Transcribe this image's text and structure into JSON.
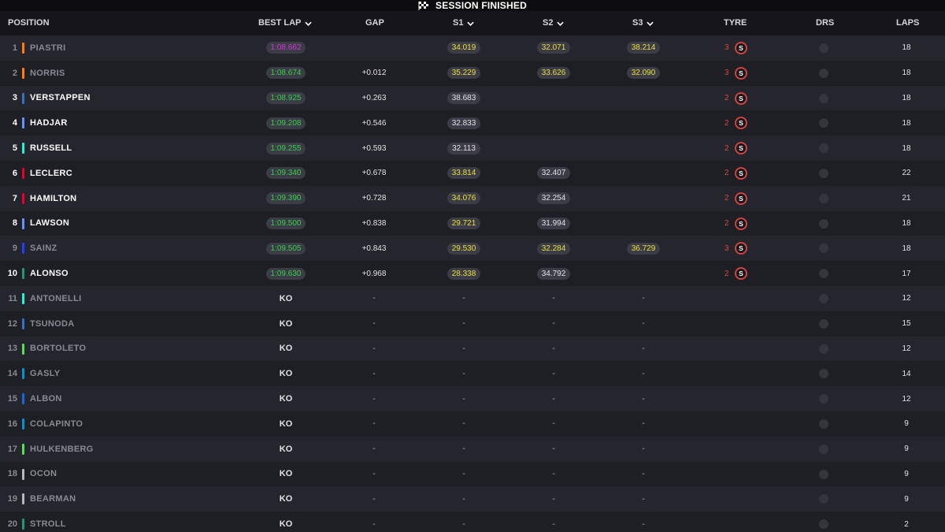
{
  "session": {
    "title": "SESSION FINISHED"
  },
  "columns": {
    "position": "POSITION",
    "best_lap": "BEST LAP",
    "gap": "GAP",
    "s1": "S1",
    "s2": "S2",
    "s3": "S3",
    "tyre": "TYRE",
    "drs": "DRS",
    "laps": "LAPS"
  },
  "colors": {
    "purple": "#d236d8",
    "green": "#34d049",
    "yellow": "#e7e03a",
    "tyre_soft": "#e0463f"
  },
  "tyre_compound": "S",
  "rows": [
    {
      "pos": "1",
      "driver": "PIASTRI",
      "team_color": "#ff8000",
      "dim": true,
      "best_lap": "1:08.662",
      "best_lap_color": "purple",
      "gap": "",
      "s1": "34.019",
      "s1c": "yellow",
      "s2": "32.071",
      "s2c": "yellow",
      "s3": "38.214",
      "s3c": "yellow",
      "tyre_age": "3",
      "tyre": true,
      "laps": "18"
    },
    {
      "pos": "2",
      "driver": "NORRIS",
      "team_color": "#ff8000",
      "dim": true,
      "best_lap": "1:08.674",
      "best_lap_color": "green",
      "gap": "+0.012",
      "s1": "35.229",
      "s1c": "yellow",
      "s2": "33.626",
      "s2c": "yellow",
      "s3": "32.090",
      "s3c": "yellow",
      "tyre_age": "3",
      "tyre": true,
      "laps": "18"
    },
    {
      "pos": "3",
      "driver": "VERSTAPPEN",
      "team_color": "#3671c6",
      "dim": false,
      "best_lap": "1:08.925",
      "best_lap_color": "green",
      "gap": "+0.263",
      "s1": "38.683",
      "s1c": "white",
      "s2": "",
      "s2c": "",
      "s3": "",
      "s3c": "",
      "tyre_age": "2",
      "tyre": true,
      "laps": "18"
    },
    {
      "pos": "4",
      "driver": "HADJAR",
      "team_color": "#6692ff",
      "dim": false,
      "best_lap": "1:09.208",
      "best_lap_color": "green",
      "gap": "+0.546",
      "s1": "32.833",
      "s1c": "white",
      "s2": "",
      "s2c": "",
      "s3": "",
      "s3c": "",
      "tyre_age": "2",
      "tyre": true,
      "laps": "18"
    },
    {
      "pos": "5",
      "driver": "RUSSELL",
      "team_color": "#27f4d2",
      "dim": false,
      "best_lap": "1:09.255",
      "best_lap_color": "green",
      "gap": "+0.593",
      "s1": "32.113",
      "s1c": "white",
      "s2": "",
      "s2c": "",
      "s3": "",
      "s3c": "",
      "tyre_age": "2",
      "tyre": true,
      "laps": "18"
    },
    {
      "pos": "6",
      "driver": "LECLERC",
      "team_color": "#e8002d",
      "dim": false,
      "best_lap": "1:09.340",
      "best_lap_color": "green",
      "gap": "+0.678",
      "s1": "33.814",
      "s1c": "yellow",
      "s2": "32.407",
      "s2c": "white",
      "s3": "",
      "s3c": "",
      "tyre_age": "2",
      "tyre": true,
      "laps": "22"
    },
    {
      "pos": "7",
      "driver": "HAMILTON",
      "team_color": "#e8002d",
      "dim": false,
      "best_lap": "1:09.390",
      "best_lap_color": "green",
      "gap": "+0.728",
      "s1": "34.076",
      "s1c": "yellow",
      "s2": "32.254",
      "s2c": "white",
      "s3": "",
      "s3c": "",
      "tyre_age": "2",
      "tyre": true,
      "laps": "21"
    },
    {
      "pos": "8",
      "driver": "LAWSON",
      "team_color": "#6692ff",
      "dim": false,
      "best_lap": "1:09.500",
      "best_lap_color": "green",
      "gap": "+0.838",
      "s1": "29.721",
      "s1c": "yellow",
      "s2": "31.994",
      "s2c": "white",
      "s3": "",
      "s3c": "",
      "tyre_age": "2",
      "tyre": true,
      "laps": "18"
    },
    {
      "pos": "9",
      "driver": "SAINZ",
      "team_color": "#1e41ff",
      "dim": true,
      "best_lap": "1:09.505",
      "best_lap_color": "green",
      "gap": "+0.843",
      "s1": "29.530",
      "s1c": "yellow",
      "s2": "32.284",
      "s2c": "yellow",
      "s3": "36.729",
      "s3c": "yellow",
      "tyre_age": "3",
      "tyre": true,
      "laps": "18"
    },
    {
      "pos": "10",
      "driver": "ALONSO",
      "team_color": "#229971",
      "dim": false,
      "best_lap": "1:09.630",
      "best_lap_color": "green",
      "gap": "+0.968",
      "s1": "28.338",
      "s1c": "yellow",
      "s2": "34.792",
      "s2c": "white",
      "s3": "",
      "s3c": "",
      "tyre_age": "2",
      "tyre": true,
      "laps": "17"
    },
    {
      "pos": "11",
      "driver": "ANTONELLI",
      "team_color": "#27f4d2",
      "dim": true,
      "best_lap": "KO",
      "best_lap_color": "ko",
      "gap": "-",
      "s1": "-",
      "s1c": "dash",
      "s2": "-",
      "s2c": "dash",
      "s3": "-",
      "s3c": "dash",
      "tyre_age": "",
      "tyre": false,
      "laps": "12"
    },
    {
      "pos": "12",
      "driver": "TSUNODA",
      "team_color": "#3671c6",
      "dim": true,
      "best_lap": "KO",
      "best_lap_color": "ko",
      "gap": "-",
      "s1": "-",
      "s1c": "dash",
      "s2": "-",
      "s2c": "dash",
      "s3": "-",
      "s3c": "dash",
      "tyre_age": "",
      "tyre": false,
      "laps": "15"
    },
    {
      "pos": "13",
      "driver": "BORTOLETO",
      "team_color": "#52e252",
      "dim": true,
      "best_lap": "KO",
      "best_lap_color": "ko",
      "gap": "-",
      "s1": "-",
      "s1c": "dash",
      "s2": "-",
      "s2c": "dash",
      "s3": "-",
      "s3c": "dash",
      "tyre_age": "",
      "tyre": false,
      "laps": "12"
    },
    {
      "pos": "14",
      "driver": "GASLY",
      "team_color": "#0093cc",
      "dim": true,
      "best_lap": "KO",
      "best_lap_color": "ko",
      "gap": "-",
      "s1": "-",
      "s1c": "dash",
      "s2": "-",
      "s2c": "dash",
      "s3": "-",
      "s3c": "dash",
      "tyre_age": "",
      "tyre": false,
      "laps": "14"
    },
    {
      "pos": "15",
      "driver": "ALBON",
      "team_color": "#1868db",
      "dim": true,
      "best_lap": "KO",
      "best_lap_color": "ko",
      "gap": "-",
      "s1": "-",
      "s1c": "dash",
      "s2": "-",
      "s2c": "dash",
      "s3": "-",
      "s3c": "dash",
      "tyre_age": "",
      "tyre": false,
      "laps": "12"
    },
    {
      "pos": "16",
      "driver": "COLAPINTO",
      "team_color": "#0093cc",
      "dim": true,
      "best_lap": "KO",
      "best_lap_color": "ko",
      "gap": "-",
      "s1": "-",
      "s1c": "dash",
      "s2": "-",
      "s2c": "dash",
      "s3": "-",
      "s3c": "dash",
      "tyre_age": "",
      "tyre": false,
      "laps": "9"
    },
    {
      "pos": "17",
      "driver": "HULKENBERG",
      "team_color": "#52e252",
      "dim": true,
      "best_lap": "KO",
      "best_lap_color": "ko",
      "gap": "-",
      "s1": "-",
      "s1c": "dash",
      "s2": "-",
      "s2c": "dash",
      "s3": "-",
      "s3c": "dash",
      "tyre_age": "",
      "tyre": false,
      "laps": "9"
    },
    {
      "pos": "18",
      "driver": "OCON",
      "team_color": "#b6babd",
      "dim": true,
      "best_lap": "KO",
      "best_lap_color": "ko",
      "gap": "-",
      "s1": "-",
      "s1c": "dash",
      "s2": "-",
      "s2c": "dash",
      "s3": "-",
      "s3c": "dash",
      "tyre_age": "",
      "tyre": false,
      "laps": "9"
    },
    {
      "pos": "19",
      "driver": "BEARMAN",
      "team_color": "#b6babd",
      "dim": true,
      "best_lap": "KO",
      "best_lap_color": "ko",
      "gap": "-",
      "s1": "-",
      "s1c": "dash",
      "s2": "-",
      "s2c": "dash",
      "s3": "-",
      "s3c": "dash",
      "tyre_age": "",
      "tyre": false,
      "laps": "9"
    },
    {
      "pos": "20",
      "driver": "STROLL",
      "team_color": "#229971",
      "dim": true,
      "best_lap": "KO",
      "best_lap_color": "ko",
      "gap": "-",
      "s1": "-",
      "s1c": "dash",
      "s2": "-",
      "s2c": "dash",
      "s3": "-",
      "s3c": "dash",
      "tyre_age": "",
      "tyre": false,
      "laps": "2"
    }
  ]
}
